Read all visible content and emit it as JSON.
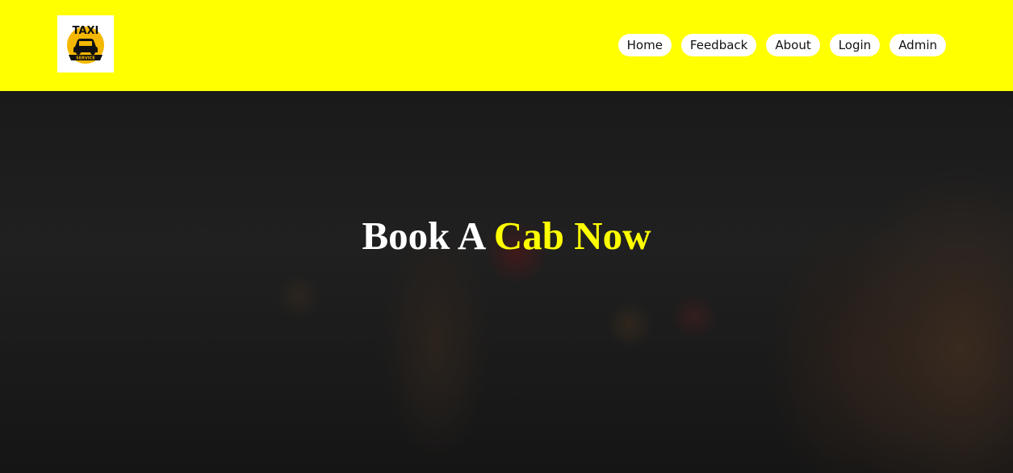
{
  "logo": {
    "text_top": "TAXI",
    "text_bottom": "SERVICE"
  },
  "nav": {
    "items": [
      {
        "label": "Home"
      },
      {
        "label": "Feedback"
      },
      {
        "label": "About"
      },
      {
        "label": "Login"
      },
      {
        "label": "Admin"
      }
    ]
  },
  "hero": {
    "title_white": "Book A",
    "title_accent": "Cab Now"
  },
  "colors": {
    "header_bg": "#ffff00",
    "accent": "#ffff00",
    "hero_text": "#ffffff"
  }
}
